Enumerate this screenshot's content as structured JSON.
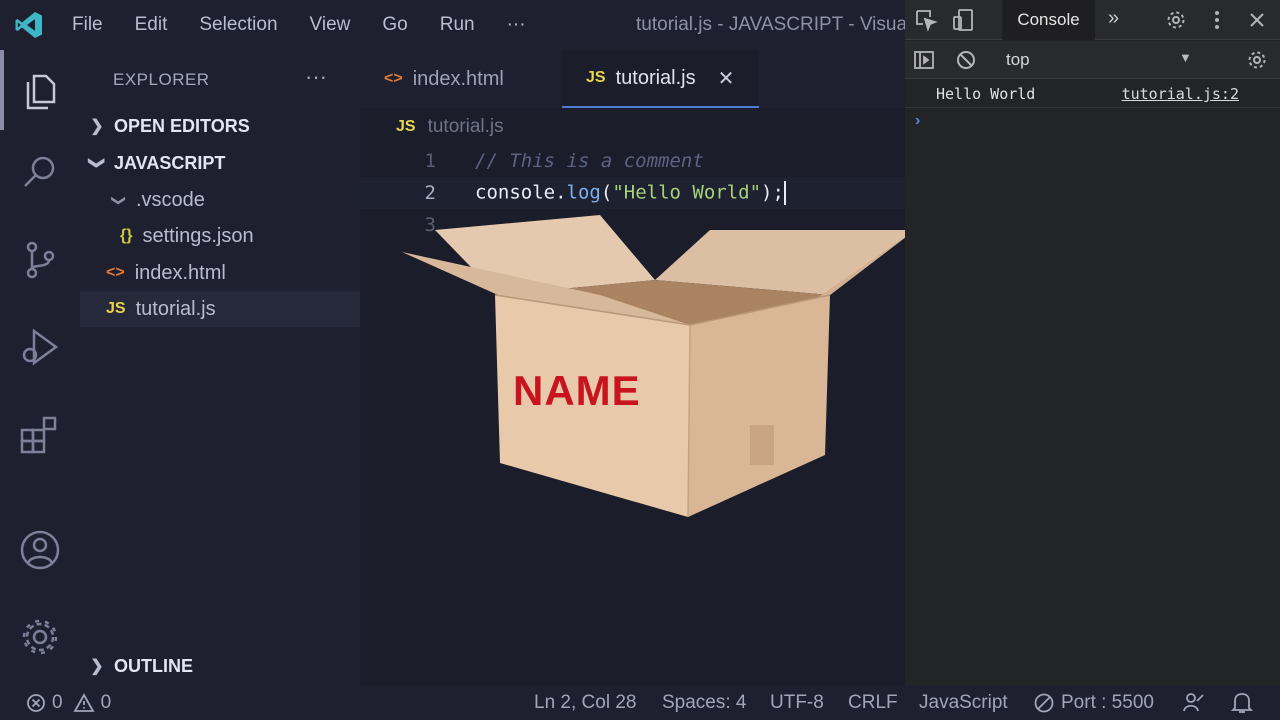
{
  "titlebar": {
    "menu": [
      "File",
      "Edit",
      "Selection",
      "View",
      "Go",
      "Run",
      "···"
    ],
    "window_title": "tutorial.js - JAVASCRIPT - Visual Studio Code"
  },
  "activitybar": {
    "icons": [
      "explorer-icon",
      "search-icon",
      "source-control-icon",
      "run-debug-icon",
      "extensions-icon",
      "account-icon",
      "settings-gear-icon"
    ]
  },
  "sidebar": {
    "header": "EXPLORER",
    "more": "···",
    "sections": {
      "open_editors": "OPEN EDITORS",
      "workspace": "JAVASCRIPT",
      "outline": "OUTLINE"
    },
    "tree": {
      "vscode_folder": ".vscode",
      "settings_file": "settings.json",
      "index_file": "index.html",
      "tutorial_file": "tutorial.js"
    },
    "icons": {
      "json": "{}",
      "html": "<>",
      "js": "JS"
    }
  },
  "editor": {
    "tabs": [
      {
        "icon": "<>",
        "label": "index.html",
        "active": false
      },
      {
        "icon": "JS",
        "label": "tutorial.js",
        "active": true
      }
    ],
    "close_glyph": "✕",
    "breadcrumb": {
      "icon": "JS",
      "label": "tutorial.js"
    },
    "lines": [
      {
        "num": "1",
        "text": "// This is a comment"
      },
      {
        "num": "2",
        "object": "console",
        "dot": ".",
        "method": "log",
        "open": "(",
        "string": "\"Hello World\"",
        "close": ");"
      },
      {
        "num": "3",
        "text": ""
      }
    ]
  },
  "overlay": {
    "label": "NAME"
  },
  "devtools": {
    "tab_label": "Console",
    "more_tabs": "»",
    "context": "top",
    "context_arrow": "▼",
    "message": "Hello World",
    "message_source": "tutorial.js:2",
    "prompt": "›"
  },
  "statusbar": {
    "errors": "0",
    "warnings": "0",
    "position": "Ln 2, Col 28",
    "spaces": "Spaces: 4",
    "encoding": "UTF-8",
    "eol": "CRLF",
    "language": "JavaScript",
    "port": "Port : 5500"
  },
  "colors": {
    "js_badge": "#e8d44d",
    "html_badge": "#e37933",
    "json_badge": "#cbcb41",
    "accent": "#4f7bd4",
    "vscode_logo": "#3fb6c8",
    "box_label": "#c8141e"
  }
}
